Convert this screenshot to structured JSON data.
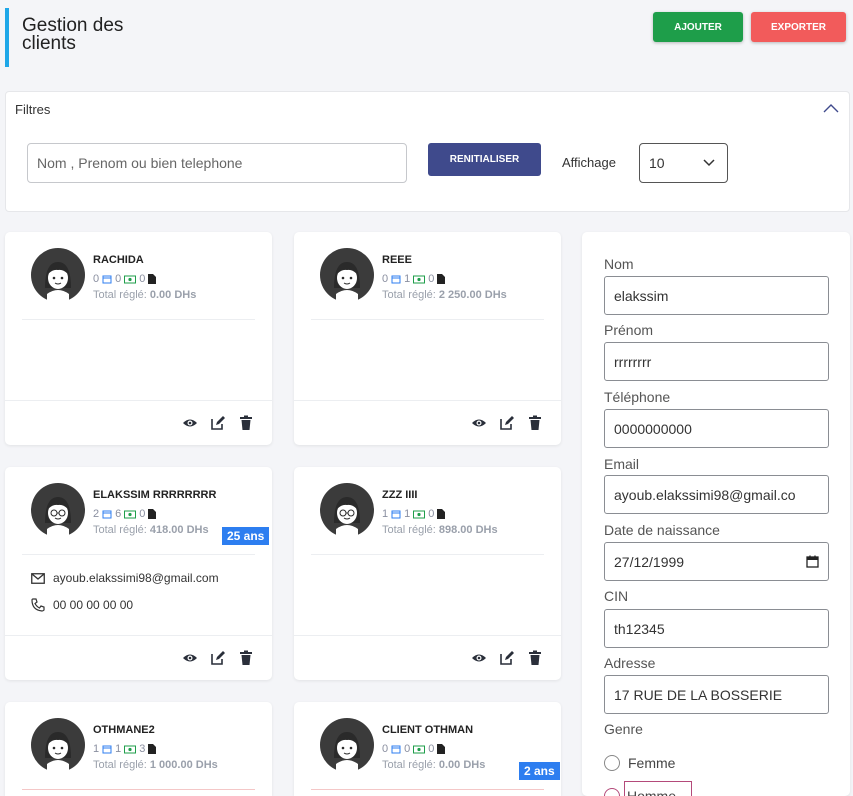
{
  "header": {
    "title": "Gestion des clients",
    "add_label": "AJOUTER",
    "export_label": "EXPORTER"
  },
  "filters": {
    "title": "Filtres",
    "search_placeholder": "Nom , Prenom ou bien telephone",
    "reset_label": "RENITIALISER",
    "affichage_label": "Affichage",
    "affichage_value": "10"
  },
  "cards": [
    {
      "name": "RACHIDA",
      "rdv": "0",
      "payments": "0",
      "docs": "0",
      "total_label": "Total réglé:",
      "total_value": "0.00 DHs"
    },
    {
      "name": "REEE",
      "rdv": "0",
      "payments": "1",
      "docs": "0",
      "total_label": "Total réglé:",
      "total_value": "2 250.00 DHs"
    },
    {
      "name": "ELAKSSIM RRRRRRRR",
      "rdv": "2",
      "payments": "6",
      "docs": "0",
      "total_label": "Total réglé:",
      "total_value": "418.00 DHs",
      "age": "25 ans",
      "email": "ayoub.elakssimi98@gmail.com",
      "phone": "00 00 00 00 00"
    },
    {
      "name": "ZZZ IIII",
      "rdv": "1",
      "payments": "1",
      "docs": "0",
      "total_label": "Total réglé:",
      "total_value": "898.00 DHs"
    },
    {
      "name": "OTHMANE2",
      "rdv": "1",
      "payments": "1",
      "docs": "3",
      "total_label": "Total réglé:",
      "total_value": "1 000.00 DHs"
    },
    {
      "name": "CLIENT OTHMAN",
      "rdv": "0",
      "payments": "0",
      "docs": "0",
      "total_label": "Total réglé:",
      "total_value": "0.00 DHs",
      "age": "2 ans"
    }
  ],
  "form": {
    "nom_label": "Nom",
    "nom_value": "elakssim",
    "prenom_label": "Prénom",
    "prenom_value": "rrrrrrrr",
    "telephone_label": "Téléphone",
    "telephone_value": "0000000000",
    "email_label": "Email",
    "email_value": "ayoub.elakssimi98@gmail.co",
    "dob_label": "Date de naissance",
    "dob_value": "27/12/1999",
    "cin_label": "CIN",
    "cin_value": "th12345",
    "adresse_label": "Adresse",
    "adresse_value": "17 RUE DE LA BOSSERIE",
    "genre_label": "Genre",
    "genre_options": [
      "Femme",
      "Homme"
    ]
  },
  "colors": {
    "accent": "#1ea7e8",
    "add": "#1e9e4a",
    "export": "#f25b5b",
    "reset": "#3f4a8c",
    "badge": "#2d7ef0"
  }
}
